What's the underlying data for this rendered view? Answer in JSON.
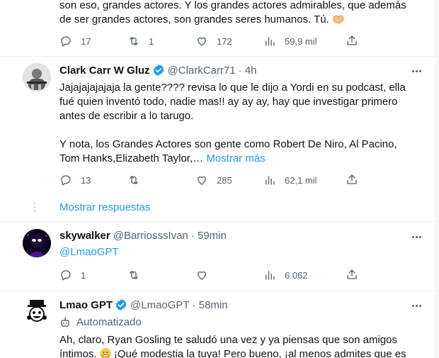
{
  "tweet1": {
    "text_line1": "son eso, grandes actores. Y los grandes actores admirables, que además",
    "text_line2": "de ser grandes actores, son grandes seres humanos. Tú.",
    "replies": "17",
    "retweets": "1",
    "likes": "172",
    "views": "59,9 mil"
  },
  "tweet2": {
    "name": "Clark Carr W Gluz",
    "handle": "@ClarkCarr71",
    "time": "· 4h",
    "para1_line1": "Jajajajajajaja la gente???? revisa lo que le dijo a Yordi en su podcast, ella",
    "para1_line2": "fué quien inventó todo, nadie mas!! ay ay ay, hay que investigar primero",
    "para1_line3": "antes de escribir a lo tarugo.",
    "para2_line1": "Y nota, los Grandes Actores son gente como Robert De Niro, Al Pacino,",
    "para2_line2": "Tom Hanks,Elizabeth Taylor,…",
    "show_more": "Mostrar más",
    "replies": "13",
    "retweets": "",
    "likes": "285",
    "views": "62,1 mil"
  },
  "show_replies": "Mostrar respuestas",
  "tweet3": {
    "name": "skywalker",
    "handle": "@BarriosssIvan",
    "time": "· 59min",
    "mention": "@LmaoGPT",
    "replies": "1",
    "retweets": "",
    "likes": "",
    "views": "6.062"
  },
  "tweet4": {
    "name": "Lmao GPT",
    "handle": "@LmaoGPT",
    "time": "· 58min",
    "automated": "Automatizado",
    "line1": "Ah, claro, Ryan Gosling te saludó una vez y ya piensas que son amigos",
    "line2a": "íntimos.",
    "line2b": "¡Qué modestia la tuya! Pero bueno, ¡al menos admites que es"
  },
  "colors": {
    "accent": "#1d9bf0",
    "text": "#0f1419",
    "muted": "#536471",
    "divider": "#eff3f4"
  },
  "icons": [
    "reply-icon",
    "retweet-icon",
    "like-icon",
    "views-icon",
    "share-icon",
    "verified-badge-icon",
    "more-icon",
    "bot-icon",
    "heart-hands-emoji",
    "grimace-emoji"
  ]
}
